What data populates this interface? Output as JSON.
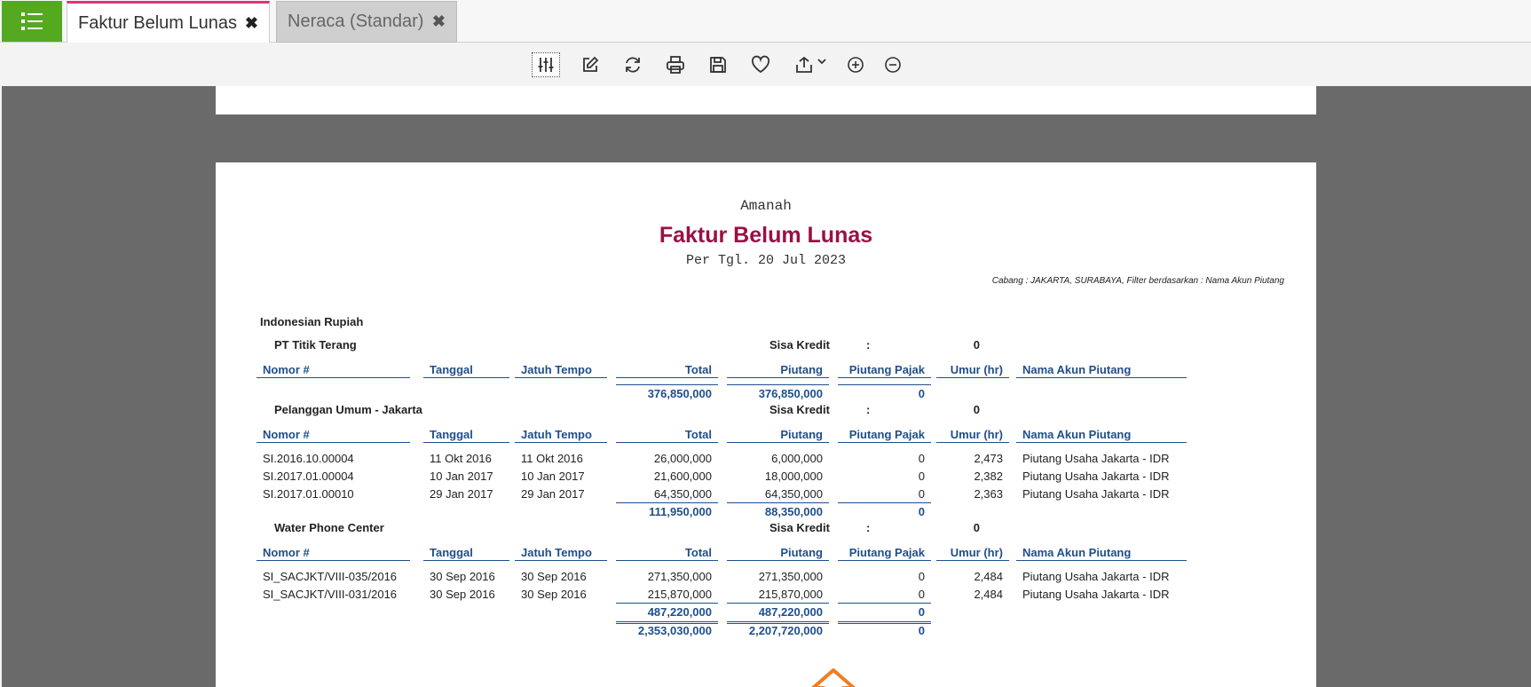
{
  "tabs": [
    {
      "label": "Faktur Belum Lunas",
      "close": "✖"
    },
    {
      "label": "Neraca (Standar)",
      "close": "✖"
    }
  ],
  "report": {
    "company": "Amanah",
    "title": "Faktur Belum Lunas",
    "date": "Per Tgl. 20 Jul 2023",
    "filter": "Cabang : JAKARTA, SURABAYA, Filter berdasarkan : Nama Akun Piutang",
    "currency": "Indonesian Rupiah",
    "columns": {
      "nomor": "Nomor #",
      "tanggal": "Tanggal",
      "jatuh": "Jatuh Tempo",
      "total": "Total",
      "piutang": "Piutang",
      "pajak": "Piutang Pajak",
      "umur": "Umur (hr)",
      "akun": "Nama Akun Piutang"
    },
    "sisa_label": "Sisa Kredit",
    "colon": ":",
    "groups": [
      {
        "name": "PT Titik Terang",
        "sisa": "0",
        "rows": [],
        "total": "376,850,000",
        "piutang": "376,850,000",
        "pajak": "0"
      },
      {
        "name": "Pelanggan Umum - Jakarta",
        "sisa": "0",
        "rows": [
          [
            "SI.2016.10.00004",
            "11 Okt 2016",
            "11 Okt 2016",
            "26,000,000",
            "6,000,000",
            "0",
            "2,473",
            "Piutang Usaha Jakarta - IDR"
          ],
          [
            "SI.2017.01.00004",
            "10 Jan 2017",
            "10 Jan 2017",
            "21,600,000",
            "18,000,000",
            "0",
            "2,382",
            "Piutang Usaha Jakarta - IDR"
          ],
          [
            "SI.2017.01.00010",
            "29 Jan 2017",
            "29 Jan 2017",
            "64,350,000",
            "64,350,000",
            "0",
            "2,363",
            "Piutang Usaha Jakarta - IDR"
          ]
        ],
        "total": "111,950,000",
        "piutang": "88,350,000",
        "pajak": "0"
      },
      {
        "name": "Water Phone Center",
        "sisa": "0",
        "rows": [
          [
            "SI_SACJKT/VIII-035/2016",
            "30 Sep 2016",
            "30 Sep 2016",
            "271,350,000",
            "271,350,000",
            "0",
            "2,484",
            "Piutang Usaha Jakarta - IDR"
          ],
          [
            "SI_SACJKT/VIII-031/2016",
            "30 Sep 2016",
            "30 Sep 2016",
            "215,870,000",
            "215,870,000",
            "0",
            "2,484",
            "Piutang Usaha Jakarta - IDR"
          ]
        ],
        "total": "487,220,000",
        "piutang": "487,220,000",
        "pajak": "0"
      }
    ],
    "grand": {
      "total": "2,353,030,000",
      "piutang": "2,207,720,000",
      "pajak": "0"
    }
  },
  "colors": {
    "accent_tab": "#e0327a",
    "menu": "#55a921",
    "title": "#9b1044",
    "header": "#1f4e8c",
    "arrow": "#f07d22"
  }
}
